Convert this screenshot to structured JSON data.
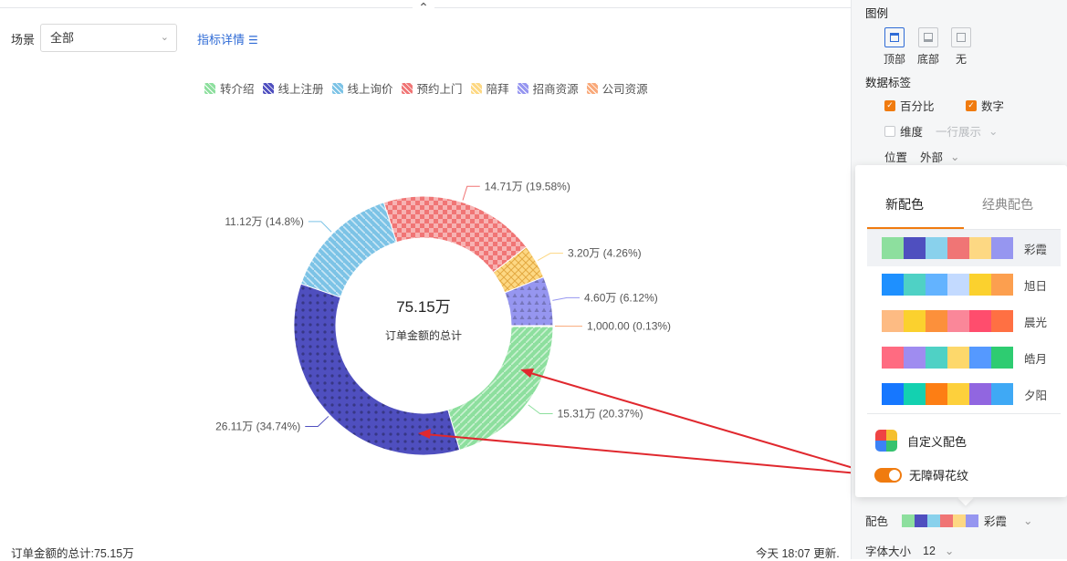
{
  "toolbar": {
    "collapse_icon": "chevron-double-up-icon"
  },
  "filter": {
    "label": "场景",
    "value": "全部"
  },
  "metric_link": {
    "label": "指标详情"
  },
  "chart_data": {
    "type": "pie",
    "style": "donut",
    "center_value": "75.15万",
    "center_label": "订单金额的总计",
    "series": [
      {
        "name": "转介绍",
        "value": 15.31,
        "percent": 20.37,
        "label": "15.31万 (20.37%)",
        "color": "#8ddf9e",
        "pattern": "diagonal"
      },
      {
        "name": "线上注册",
        "value": 26.11,
        "percent": 34.74,
        "label": "26.11万 (34.74%)",
        "color": "#4f4fbf",
        "pattern": "dots"
      },
      {
        "name": "线上询价",
        "value": 11.12,
        "percent": 14.8,
        "label": "11.12万 (14.8%)",
        "color": "#7cc3e6",
        "pattern": "diagonal-rev"
      },
      {
        "name": "预约上门",
        "value": 14.71,
        "percent": 19.58,
        "label": "14.71万 (19.58%)",
        "color": "#f07575",
        "pattern": "checker"
      },
      {
        "name": "陪拜",
        "value": 3.2,
        "percent": 4.26,
        "label": "3.20万 (4.26%)",
        "color": "#fdd883",
        "pattern": "cross"
      },
      {
        "name": "招商资源",
        "value": 4.6,
        "percent": 6.12,
        "label": "4.60万 (6.12%)",
        "color": "#9696f0",
        "pattern": "triangles"
      },
      {
        "name": "公司资源",
        "value": 0.1,
        "percent": 0.13,
        "label": "1,000.00 (0.13%)",
        "color": "#f9a97a",
        "pattern": "diagonal"
      }
    ],
    "legend_position": "top"
  },
  "footer": {
    "total_text": "订单金额的总计:75.15万",
    "updated_text": "今天 18:07 更新."
  },
  "side": {
    "legend_title": "图例",
    "legend_positions": [
      {
        "label": "顶部",
        "active": true
      },
      {
        "label": "底部",
        "active": false
      },
      {
        "label": "无",
        "active": false
      }
    ],
    "data_label_title": "数据标签",
    "percent_label": "百分比",
    "number_label": "数字",
    "dimension_label": "维度",
    "one_line_label": "一行展示",
    "position_label": "位置",
    "position_value": "外部",
    "color_label": "配色",
    "color_value": "彩霞",
    "font_size_label": "字体大小",
    "font_size_value": "12"
  },
  "popover": {
    "tab_new": "新配色",
    "tab_classic": "经典配色",
    "schemes": [
      {
        "name": "彩霞",
        "active": true,
        "colors": [
          "#8ddf9e",
          "#4f4fbf",
          "#89d1ec",
          "#f07575",
          "#fdd883",
          "#9696f0"
        ]
      },
      {
        "name": "旭日",
        "active": false,
        "colors": [
          "#1e90ff",
          "#4fd1c5",
          "#63b3ff",
          "#c3daff",
          "#fbd12e",
          "#fc9f4f"
        ]
      },
      {
        "name": "晨光",
        "active": false,
        "colors": [
          "#fdbb83",
          "#fbd12e",
          "#fc903b",
          "#fa8799",
          "#ff4d6d",
          "#ff7043"
        ]
      },
      {
        "name": "皓月",
        "active": false,
        "colors": [
          "#ff6b81",
          "#9f8cf0",
          "#4fd1c5",
          "#fdd86b",
          "#5599ff",
          "#2ecc71"
        ]
      },
      {
        "name": "夕阳",
        "active": false,
        "colors": [
          "#1677ff",
          "#13d1b0",
          "#fd7e14",
          "#fdd03c",
          "#9166e0",
          "#3fa9f5"
        ]
      }
    ],
    "custom_label": "自定义配色",
    "accessible_label": "无障碍花纹"
  }
}
